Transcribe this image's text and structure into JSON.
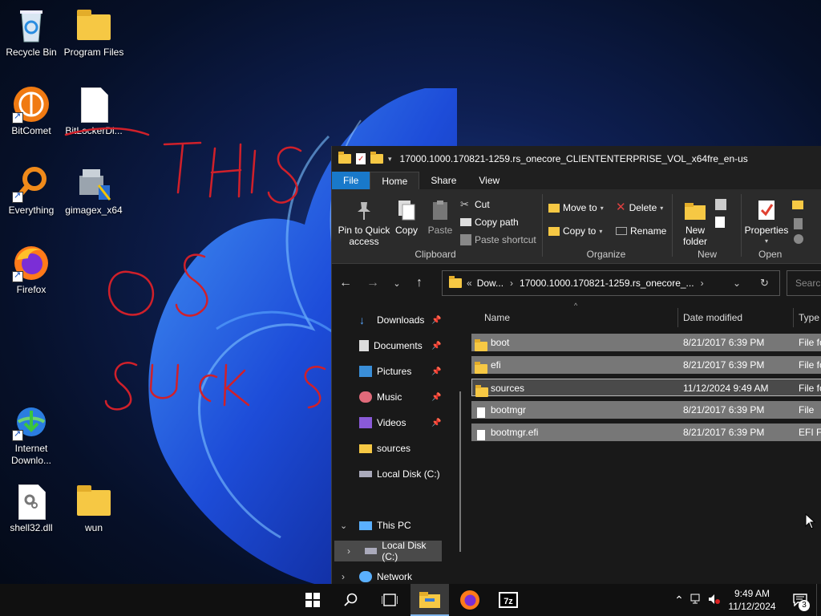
{
  "desktop": {
    "icons": [
      {
        "label": "Recycle Bin"
      },
      {
        "label": "Program Files"
      },
      {
        "label": "BitComet"
      },
      {
        "label": "BitLockerDi..."
      },
      {
        "label": "Everything"
      },
      {
        "label": "gimagex_x64"
      },
      {
        "label": "Firefox"
      },
      {
        "label": "Internet Downlo..."
      },
      {
        "label": "shell32.dll"
      },
      {
        "label": "wun"
      }
    ]
  },
  "explorer": {
    "title": "17000.1000.170821-1259.rs_onecore_CLIENTENTERPRISE_VOL_x64fre_en-us",
    "tabs": [
      "File",
      "Home",
      "Share",
      "View"
    ],
    "ribbon": {
      "clipboard": {
        "pin": "Pin to Quick access",
        "copy": "Copy",
        "paste": "Paste",
        "cut": "Cut",
        "copy_path": "Copy path",
        "paste_shortcut": "Paste shortcut",
        "group": "Clipboard"
      },
      "organize": {
        "move_to": "Move to",
        "copy_to": "Copy to",
        "delete": "Delete",
        "rename": "Rename",
        "group": "Organize"
      },
      "new": {
        "new_folder": "New folder",
        "group": "New"
      },
      "open": {
        "properties": "Properties",
        "group": "Open"
      }
    },
    "address": {
      "prefix": "«",
      "seg1": "Dow...",
      "seg2": "17000.1000.170821-1259.rs_onecore_...",
      "search_placeholder": "Search"
    },
    "nav": {
      "quick": [
        {
          "label": "Downloads",
          "pinned": true
        },
        {
          "label": "Documents",
          "pinned": true
        },
        {
          "label": "Pictures",
          "pinned": true
        },
        {
          "label": "Music",
          "pinned": true
        },
        {
          "label": "Videos",
          "pinned": true
        },
        {
          "label": "sources",
          "pinned": false
        },
        {
          "label": "Local Disk (C:)",
          "pinned": false
        }
      ],
      "this_pc": "This PC",
      "local_disk": "Local Disk (C:)",
      "network": "Network"
    },
    "columns": {
      "name": "Name",
      "date": "Date modified",
      "type": "Type"
    },
    "files": [
      {
        "name": "boot",
        "date": "8/21/2017 6:39 PM",
        "type": "File fo",
        "kind": "folder"
      },
      {
        "name": "efi",
        "date": "8/21/2017 6:39 PM",
        "type": "File fo",
        "kind": "folder"
      },
      {
        "name": "sources",
        "date": "11/12/2024 9:49 AM",
        "type": "File fo",
        "kind": "folder"
      },
      {
        "name": "bootmgr",
        "date": "8/21/2017 6:39 PM",
        "type": "File",
        "kind": "file"
      },
      {
        "name": "bootmgr.efi",
        "date": "8/21/2017 6:39 PM",
        "type": "EFI Fil",
        "kind": "file"
      }
    ]
  },
  "taskbar": {
    "time": "9:49 AM",
    "date": "11/12/2024",
    "notifications": "3"
  },
  "colors": {
    "accent": "#1979ca",
    "folder": "#f6c844",
    "scribble": "#d0202a"
  }
}
